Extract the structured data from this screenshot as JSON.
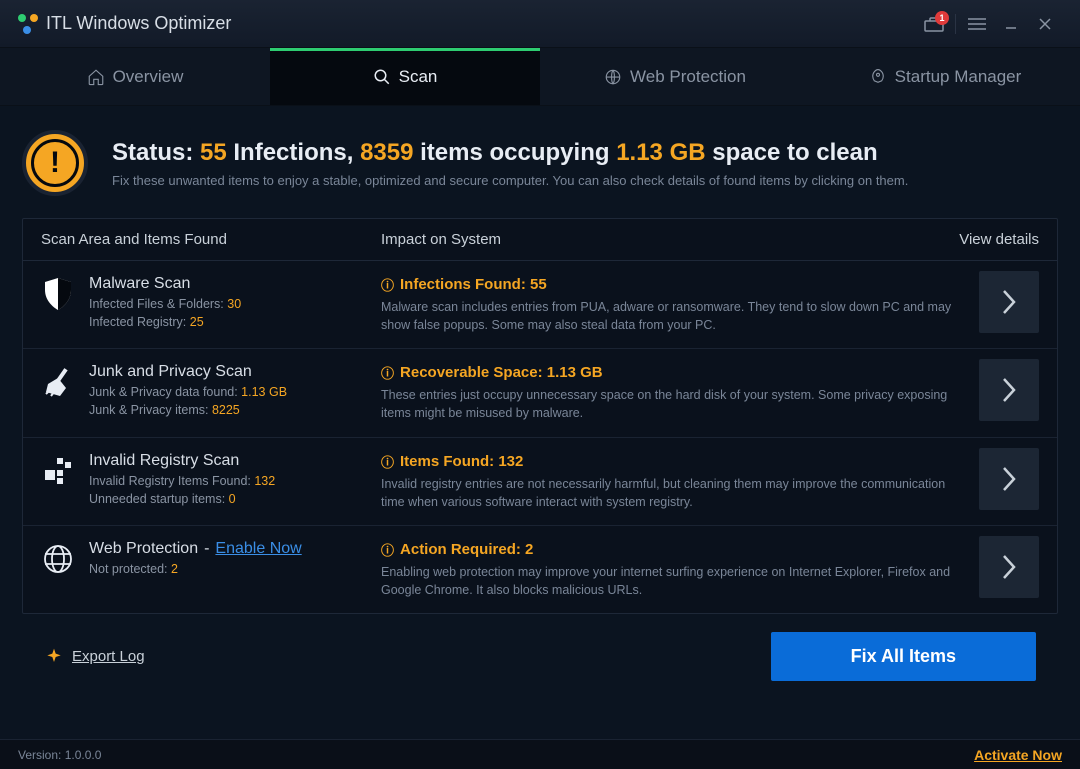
{
  "app": {
    "title": "ITL Windows Optimizer",
    "notification_count": "1",
    "version_label": "Version: 1.0.0.0",
    "activate_label": "Activate Now"
  },
  "tabs": {
    "overview": "Overview",
    "scan": "Scan",
    "web_protection": "Web Protection",
    "startup_manager": "Startup Manager"
  },
  "status": {
    "prefix": "Status: ",
    "infections_count": "55",
    "infections_word": " Infections, ",
    "items_count": "8359",
    "items_word": " items occupying ",
    "size": "1.13 GB",
    "suffix": " space to clean",
    "subtext": "Fix these unwanted items to enjoy a stable, optimized and secure computer. You can also check details of found items by clicking on them."
  },
  "table": {
    "header_area": "Scan Area and Items Found",
    "header_impact": "Impact on System",
    "header_details": "View details"
  },
  "rows": [
    {
      "title": "Malware Scan",
      "meta1_label": "Infected Files & Folders: ",
      "meta1_value": "30",
      "meta2_label": "Infected Registry: ",
      "meta2_value": "25",
      "impact_title": "Infections Found: 55",
      "impact_desc": "Malware scan includes entries from PUA, adware or ransomware. They tend to slow down PC and may show false popups. Some may also steal data from your PC."
    },
    {
      "title": "Junk and Privacy Scan",
      "meta1_label": "Junk & Privacy data found: ",
      "meta1_value": "1.13 GB",
      "meta2_label": "Junk & Privacy items: ",
      "meta2_value": "8225",
      "impact_title": "Recoverable Space: 1.13 GB",
      "impact_desc": "These entries just occupy unnecessary space on the hard disk of your system. Some privacy exposing items might be misused by malware."
    },
    {
      "title": "Invalid Registry Scan",
      "meta1_label": "Invalid Registry Items Found: ",
      "meta1_value": "132",
      "meta2_label": "Unneeded startup items: ",
      "meta2_value": "0",
      "impact_title": "Items Found: 132",
      "impact_desc": "Invalid registry entries are not necessarily harmful, but cleaning them may improve the communication time when various software interact with system registry."
    },
    {
      "title": "Web Protection",
      "title_dash": "  -  ",
      "enable_label": "Enable Now",
      "meta1_label": "Not protected: ",
      "meta1_value": "2",
      "impact_title": "Action Required: 2",
      "impact_desc": "Enabling web protection may improve your internet surfing experience on Internet Explorer, Firefox and Google Chrome. It also blocks malicious URLs."
    }
  ],
  "footer": {
    "export_log": "Export Log",
    "fix_button": "Fix All Items"
  }
}
